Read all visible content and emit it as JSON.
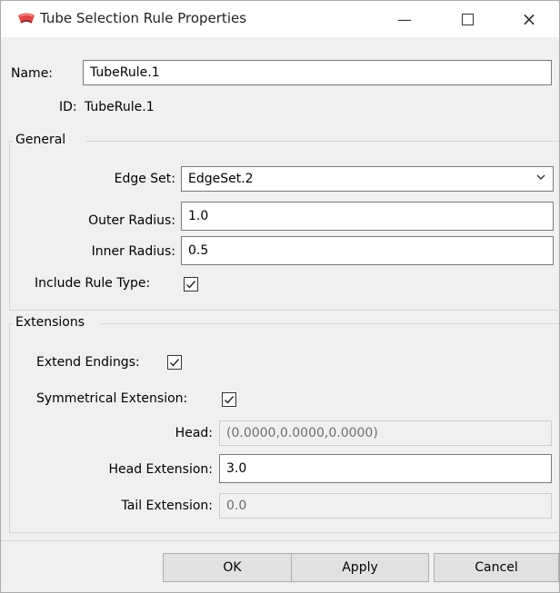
{
  "window": {
    "title": "Tube Selection Rule Properties",
    "icon": "tube-rule-icon"
  },
  "name_label": "Name:",
  "name_value": "TubeRule.1",
  "id_label": "ID:",
  "id_value": "TubeRule.1",
  "general": {
    "title": "General",
    "edge_set_label": "Edge Set:",
    "edge_set_value": "EdgeSet.2",
    "outer_radius_label": "Outer Radius:",
    "outer_radius_value": "1.0",
    "inner_radius_label": "Inner Radius:",
    "inner_radius_value": "0.5",
    "include_rule_type_label": "Include Rule Type:",
    "include_rule_type_checked": true
  },
  "extensions": {
    "title": "Extensions",
    "extend_endings_label": "Extend Endings:",
    "extend_endings_checked": true,
    "symmetrical_label": "Symmetrical Extension:",
    "symmetrical_checked": true,
    "head_label": "Head:",
    "head_value": "(0.0000,0.0000,0.0000)",
    "head_extension_label": "Head Extension:",
    "head_extension_value": "3.0",
    "tail_extension_label": "Tail Extension:",
    "tail_extension_value": "0.0"
  },
  "buttons": {
    "ok": "OK",
    "apply": "Apply",
    "cancel": "Cancel"
  }
}
